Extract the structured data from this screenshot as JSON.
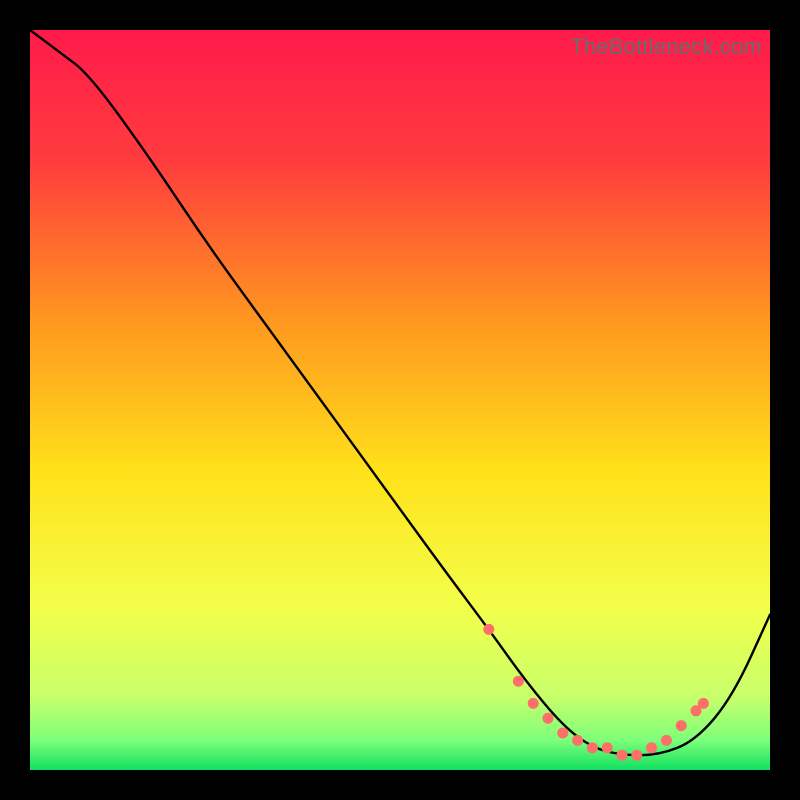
{
  "watermark": "TheBottleneck.com",
  "chart_data": {
    "type": "line",
    "title": "",
    "xlabel": "",
    "ylabel": "",
    "xlim": [
      0,
      100
    ],
    "ylim": [
      0,
      100
    ],
    "gradient_stops": [
      {
        "offset": 0,
        "color": "#ff1a4b"
      },
      {
        "offset": 18,
        "color": "#ff3d3d"
      },
      {
        "offset": 40,
        "color": "#ff9a1f"
      },
      {
        "offset": 60,
        "color": "#ffe21a"
      },
      {
        "offset": 78,
        "color": "#f3ff4a"
      },
      {
        "offset": 90,
        "color": "#c8ff6a"
      },
      {
        "offset": 96,
        "color": "#7dff7a"
      },
      {
        "offset": 100,
        "color": "#10e060"
      }
    ],
    "series": [
      {
        "name": "bottleneck-curve",
        "x": [
          0,
          4,
          8,
          16,
          24,
          32,
          40,
          48,
          56,
          62,
          67,
          72,
          76,
          80,
          85,
          90,
          95,
          100
        ],
        "y": [
          100,
          97,
          94,
          83,
          71,
          60,
          49,
          38,
          27,
          19,
          12,
          6,
          3,
          2,
          2,
          4,
          10,
          21
        ]
      }
    ],
    "markers": {
      "name": "highlight-dots",
      "color": "#ff6f69",
      "points": [
        {
          "x": 62,
          "y": 19
        },
        {
          "x": 66,
          "y": 12
        },
        {
          "x": 68,
          "y": 9
        },
        {
          "x": 70,
          "y": 7
        },
        {
          "x": 72,
          "y": 5
        },
        {
          "x": 74,
          "y": 4
        },
        {
          "x": 76,
          "y": 3
        },
        {
          "x": 78,
          "y": 3
        },
        {
          "x": 80,
          "y": 2
        },
        {
          "x": 82,
          "y": 2
        },
        {
          "x": 84,
          "y": 3
        },
        {
          "x": 86,
          "y": 4
        },
        {
          "x": 88,
          "y": 6
        },
        {
          "x": 90,
          "y": 8
        },
        {
          "x": 91,
          "y": 9
        }
      ]
    }
  }
}
